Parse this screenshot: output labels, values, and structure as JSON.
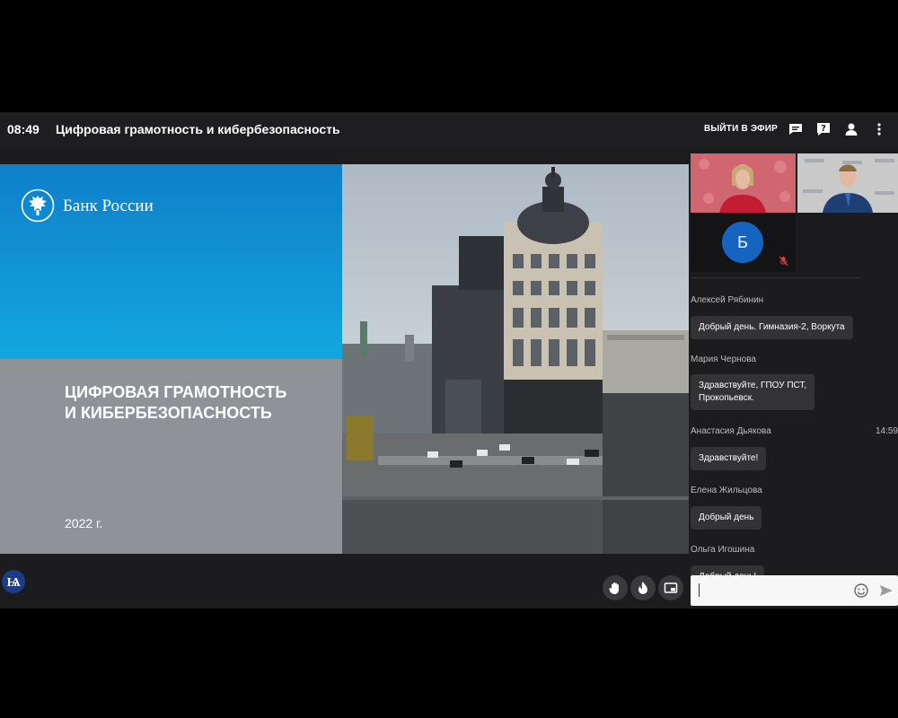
{
  "header": {
    "time": "08:49",
    "title": "Цифровая грамотность и кибербезопасность",
    "leave_label": "ВЫЙТИ В ЭФИР",
    "icons": [
      "chat-icon",
      "help-icon",
      "participants-icon",
      "more-icon"
    ]
  },
  "slide": {
    "brand": "Банк России",
    "title_line1": "ЦИФРОВАЯ ГРАМОТНОСТЬ",
    "title_line2": "И КИБЕРБЕЗОПАСНОСТЬ",
    "year": "2022 г."
  },
  "participants": {
    "avatar_letter": "Б"
  },
  "chat": {
    "messages": [
      {
        "name": "Алексей Рябинин",
        "text": "Добрый день. Гимназия-2, Воркута",
        "time": ""
      },
      {
        "name": "Мария Чернова",
        "text_line1": "Здравствуйте, ГПОУ ПСТ,",
        "text_line2": "Прокопьевск.",
        "time": ""
      },
      {
        "name": "Анастасия Дьякова",
        "text": "Здравствуйте!",
        "time": "14:59"
      },
      {
        "name": "Елена Жильцова",
        "text": "Добрый день",
        "time": ""
      },
      {
        "name": "Ольга Игошина",
        "text": "Добрый день!",
        "time": ""
      }
    ]
  },
  "controls": [
    "raise-hand-icon",
    "reaction-icon",
    "picture-in-picture-icon"
  ],
  "colors": {
    "accent_blue": "#12a7df",
    "avatar_blue": "#1565c0",
    "slide_gray": "#8f9297"
  }
}
